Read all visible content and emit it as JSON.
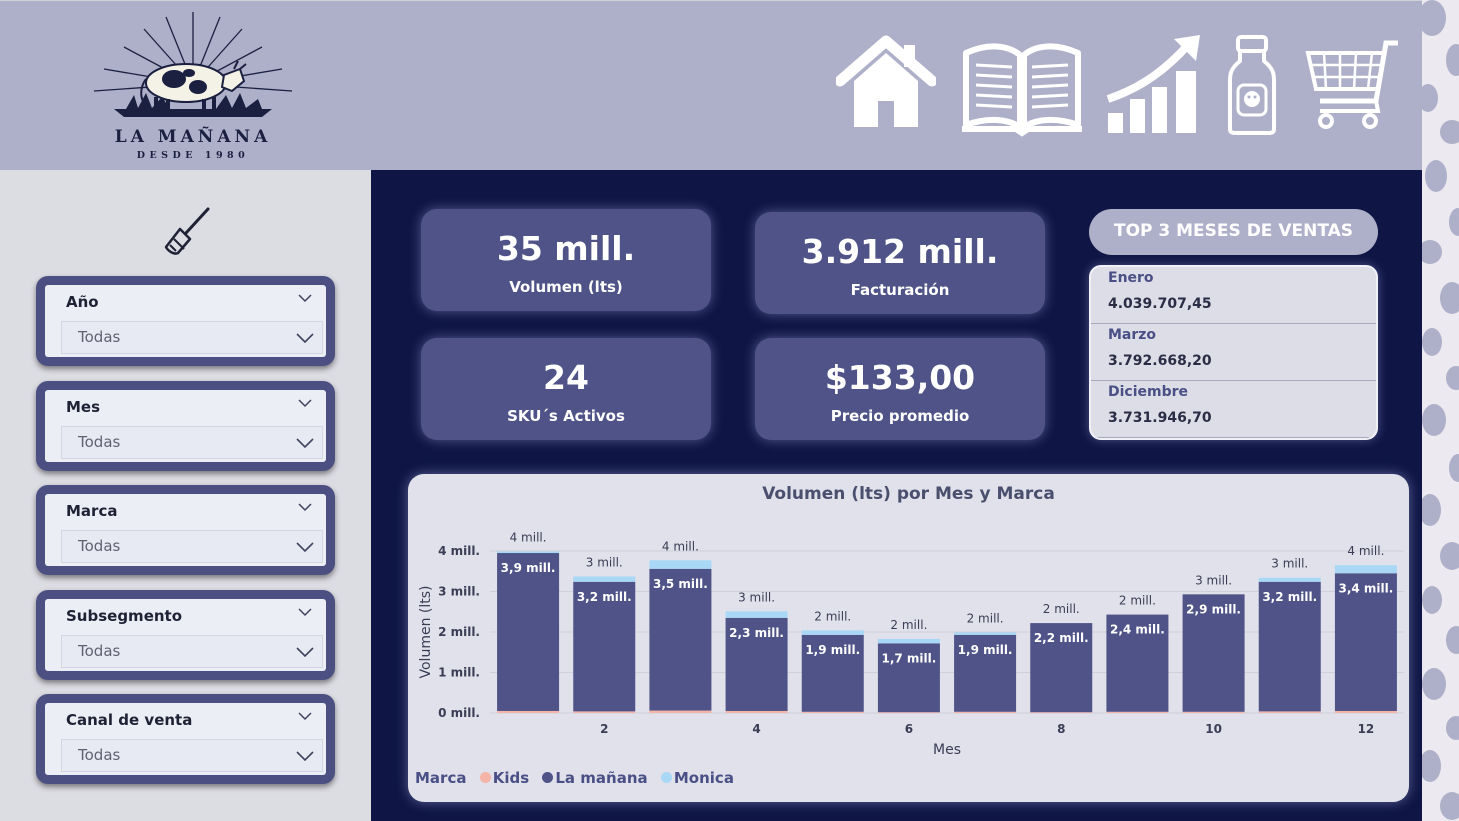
{
  "brand": {
    "name": "LA MAÑANA",
    "tagline": "DESDE 1980"
  },
  "nav": [
    {
      "icon": "home-icon"
    },
    {
      "icon": "book-icon"
    },
    {
      "icon": "growth-chart-icon"
    },
    {
      "icon": "milk-bottle-icon"
    },
    {
      "icon": "shopping-cart-icon"
    }
  ],
  "clear_filters_icon": "broom-icon",
  "filters": [
    {
      "label": "Año",
      "value": "Todas"
    },
    {
      "label": "Mes",
      "value": "Todas"
    },
    {
      "label": "Marca",
      "value": "Todas"
    },
    {
      "label": "Subsegmento",
      "value": "Todas"
    },
    {
      "label": "Canal de venta",
      "value": "Todas"
    }
  ],
  "kpis": {
    "volumen": {
      "value": "35 mill.",
      "label": "Volumen (lts)"
    },
    "facturacion": {
      "value": "3.912 mill.",
      "label": "Facturación"
    },
    "skus": {
      "value": "24",
      "label": "SKU´s Activos"
    },
    "precio": {
      "value": "$133,00",
      "label": "Precio promedio"
    }
  },
  "top3": {
    "title": "TOP 3 MESES DE VENTAS",
    "rows": [
      {
        "month": "Enero",
        "value": "4.039.707,45"
      },
      {
        "month": "Marzo",
        "value": "3.792.668,20"
      },
      {
        "month": "Diciembre",
        "value": "3.731.946,70"
      }
    ]
  },
  "colors": {
    "kids": "#f5b4a8",
    "la_manana": "#4f5387",
    "monica": "#a8d8f5",
    "accent": "#aeb0c9",
    "main_bg": "#0f1646"
  },
  "chart_data": {
    "type": "bar",
    "stacked": true,
    "title": "Volumen (lts) por Mes y Marca",
    "xlabel": "Mes",
    "ylabel": "Volumen (lts)",
    "x_tick_labels": [
      "2",
      "4",
      "6",
      "8",
      "10",
      "12"
    ],
    "y_tick_labels": [
      "0 mill.",
      "1 mill.",
      "2 mill.",
      "3 mill.",
      "4 mill."
    ],
    "ylim": [
      0,
      4
    ],
    "legend_title": "Marca",
    "legend_position": "bottom-left",
    "categories": [
      1,
      2,
      3,
      4,
      5,
      6,
      7,
      8,
      9,
      10,
      11,
      12
    ],
    "series": [
      {
        "name": "Kids",
        "color": "#f5b4a8",
        "values": [
          0.05,
          0.04,
          0.06,
          0.05,
          0.03,
          0.02,
          0.03,
          0.02,
          0.03,
          0.03,
          0.04,
          0.05
        ]
      },
      {
        "name": "La mañana",
        "color": "#4f5387",
        "values": [
          3.9,
          3.2,
          3.5,
          2.3,
          1.9,
          1.7,
          1.9,
          2.2,
          2.4,
          2.9,
          3.2,
          3.4
        ]
      },
      {
        "name": "Monica",
        "color": "#a8d8f5",
        "values": [
          0.04,
          0.13,
          0.21,
          0.16,
          0.11,
          0.11,
          0.06,
          0.0,
          0.0,
          0.0,
          0.1,
          0.2
        ]
      }
    ],
    "segment_labels": [
      "3,9 mill.",
      "3,2 mill.",
      "3,5 mill.",
      "2,3 mill.",
      "1,9 mill.",
      "1,7 mill.",
      "1,9 mill.",
      "2,2 mill.",
      "2,4 mill.",
      "2,9 mill.",
      "3,2 mill.",
      "3,4 mill."
    ],
    "total_labels": [
      "4 mill.",
      "3 mill.",
      "4 mill.",
      "3 mill.",
      "2 mill.",
      "2 mill.",
      "2 mill.",
      "2 mill.",
      "2 mill.",
      "3 mill.",
      "3 mill.",
      "4 mill."
    ]
  }
}
